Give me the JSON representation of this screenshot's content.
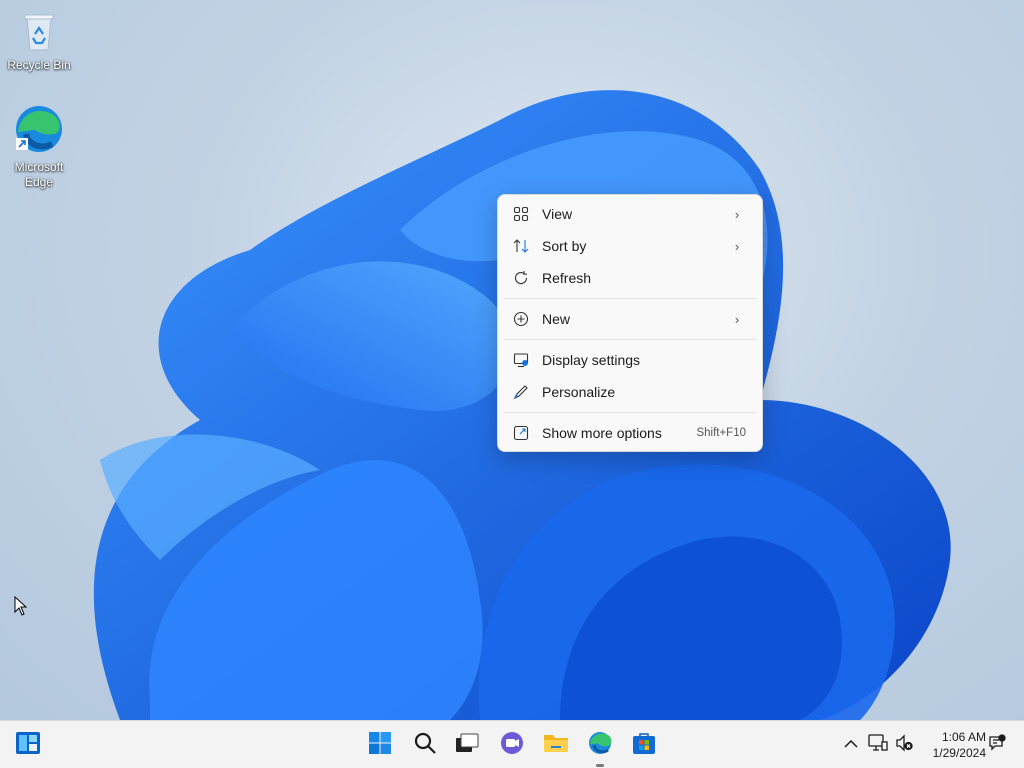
{
  "desktop": {
    "icons": [
      {
        "label": "Recycle Bin",
        "icon": "recycle-bin-icon"
      },
      {
        "label": "Microsoft Edge",
        "icon": "edge-icon"
      }
    ]
  },
  "context_menu": {
    "items": [
      {
        "label": "View",
        "icon": "view-grid-icon",
        "submenu": true
      },
      {
        "label": "Sort by",
        "icon": "sort-icon",
        "submenu": true
      },
      {
        "label": "Refresh",
        "icon": "refresh-icon",
        "submenu": false
      },
      {
        "label": "New",
        "icon": "new-plus-icon",
        "submenu": true
      },
      {
        "label": "Display settings",
        "icon": "display-settings-icon",
        "submenu": false
      },
      {
        "label": "Personalize",
        "icon": "personalize-pen-icon",
        "submenu": false
      },
      {
        "label": "Show more options",
        "icon": "show-more-options-icon",
        "shortcut": "Shift+F10"
      }
    ]
  },
  "taskbar": {
    "apps": [
      "widgets-icon",
      "start-icon",
      "search-icon",
      "task-view-icon",
      "chat-icon",
      "file-explorer-icon",
      "edge-icon",
      "store-icon"
    ],
    "tray": [
      "show-hidden-icons-chevron",
      "network-icon",
      "volume-muted-icon",
      "notification-icon"
    ],
    "clock": {
      "time": "1:06 AM",
      "date": "1/29/2024"
    }
  },
  "colors": {
    "accent": "#0067c0",
    "wallpaper_blue": "#1a6ff0",
    "menu_bg": "#f9f9f9",
    "taskbar_bg": "#f3f3f3"
  }
}
